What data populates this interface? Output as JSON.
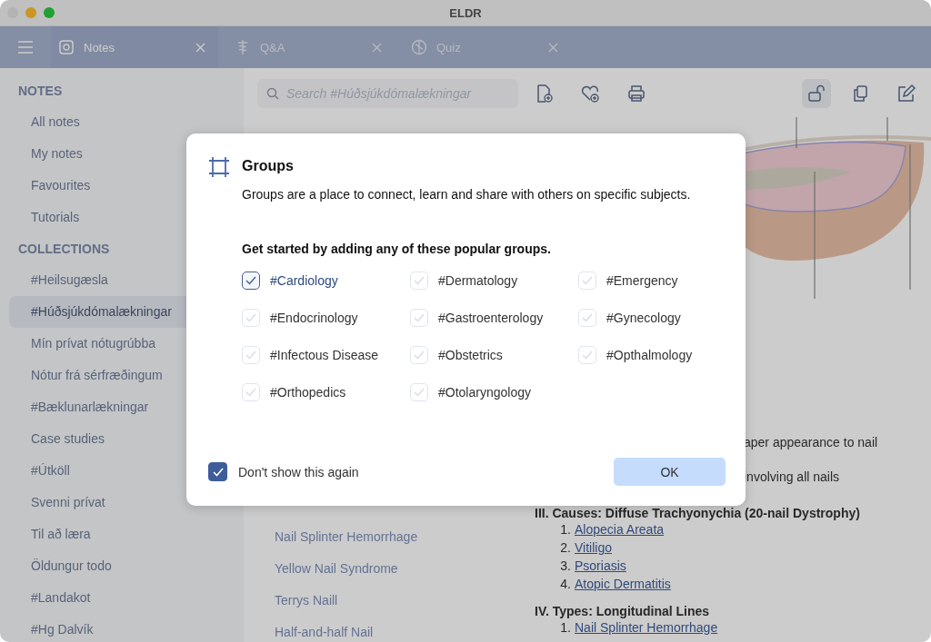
{
  "window": {
    "title": "ELDR"
  },
  "tabs": [
    {
      "label": "Notes",
      "selected": true
    },
    {
      "label": "Q&A",
      "selected": false
    },
    {
      "label": "Quiz",
      "selected": false
    }
  ],
  "sidebar": {
    "sections": [
      {
        "heading": "NOTES",
        "items": [
          {
            "label": "All notes",
            "selected": false
          },
          {
            "label": "My notes",
            "selected": false
          },
          {
            "label": "Favourites",
            "selected": false
          },
          {
            "label": "Tutorials",
            "selected": false
          }
        ]
      },
      {
        "heading": "COLLECTIONS",
        "items": [
          {
            "label": "#Heilsugæsla",
            "selected": false
          },
          {
            "label": "#Húðsjúkdómalækningar",
            "selected": true
          },
          {
            "label": "Mín prívat nótugrúbba",
            "selected": false
          },
          {
            "label": "Nótur frá sérfræðingum",
            "selected": false
          },
          {
            "label": "#Bæklunarlækningar",
            "selected": false
          },
          {
            "label": "Case studies",
            "selected": false
          },
          {
            "label": "#Útköll",
            "selected": false
          },
          {
            "label": "Svenni prívat",
            "selected": false
          },
          {
            "label": "Til að læra",
            "selected": false
          },
          {
            "label": "Öldungur todo",
            "selected": false
          },
          {
            "label": "#Landakot",
            "selected": false
          },
          {
            "label": "#Hg Dalvík",
            "selected": false
          }
        ]
      }
    ]
  },
  "search": {
    "placeholder": "Search #Húðsjúkdómalækningar"
  },
  "note_list": [
    "Nail Splinter Hemorrhage",
    "Yellow Nail Syndrome",
    "Terrys Naill",
    "Half-and-half Nail"
  ],
  "note_content": {
    "fragments": [
      "aper appearance to nail",
      "involving all nails"
    ],
    "sections": [
      {
        "heading": "III. Causes: Diffuse Trachyonychia (20-nail Dystrophy)",
        "items": [
          {
            "number": "1.",
            "text": "Alopecia Areata"
          },
          {
            "number": "2.",
            "text": "Vitiligo"
          },
          {
            "number": "3.",
            "text": "Psoriasis"
          },
          {
            "number": "4.",
            "text": "Atopic Dermatitis"
          }
        ]
      },
      {
        "heading": "IV. Types: Longitudinal Lines",
        "items": [
          {
            "number": "1.",
            "text": "Nail Splinter Hemorrhage"
          }
        ]
      }
    ]
  },
  "dialog": {
    "title": "Groups",
    "description": "Groups are a place to connect, learn and share with others on specific subjects.",
    "prompt": "Get started by adding any of these popular groups.",
    "groups": [
      {
        "label": "#Cardiology",
        "selected": true
      },
      {
        "label": "#Dermatology",
        "selected": false
      },
      {
        "label": "#Emergency",
        "selected": false
      },
      {
        "label": "#Endocrinology",
        "selected": false
      },
      {
        "label": "#Gastroenterology",
        "selected": false
      },
      {
        "label": "#Gynecology",
        "selected": false
      },
      {
        "label": "#Infectous Disease",
        "selected": false
      },
      {
        "label": "#Obstetrics",
        "selected": false
      },
      {
        "label": "#Opthalmology",
        "selected": false
      },
      {
        "label": "#Orthopedics",
        "selected": false
      },
      {
        "label": "#Otolaryngology",
        "selected": false
      }
    ],
    "dont_show": {
      "label": "Don't show this again",
      "checked": true
    },
    "ok_button": "OK"
  }
}
